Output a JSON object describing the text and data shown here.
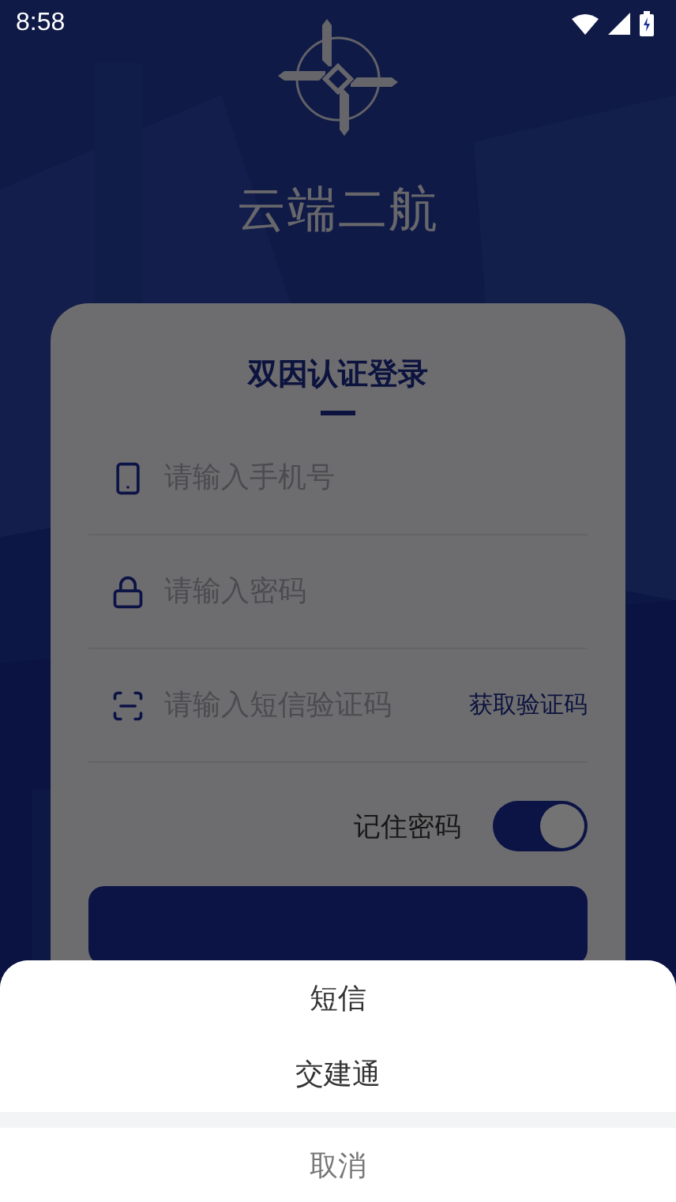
{
  "status_bar": {
    "time": "8:58"
  },
  "app": {
    "title": "云端二航"
  },
  "login_card": {
    "title": "双因认证登录",
    "fields": [
      {
        "kind": "phone",
        "placeholder": "请输入手机号"
      },
      {
        "kind": "password",
        "placeholder": "请输入密码"
      },
      {
        "kind": "code",
        "placeholder": "请输入短信验证码",
        "action": "获取验证码"
      }
    ],
    "remember": {
      "label": "记住密码",
      "on": true
    }
  },
  "action_sheet": {
    "dimmed": true,
    "options": [
      {
        "label": "短信"
      },
      {
        "label": "交建通"
      }
    ],
    "cancel": "取消"
  }
}
